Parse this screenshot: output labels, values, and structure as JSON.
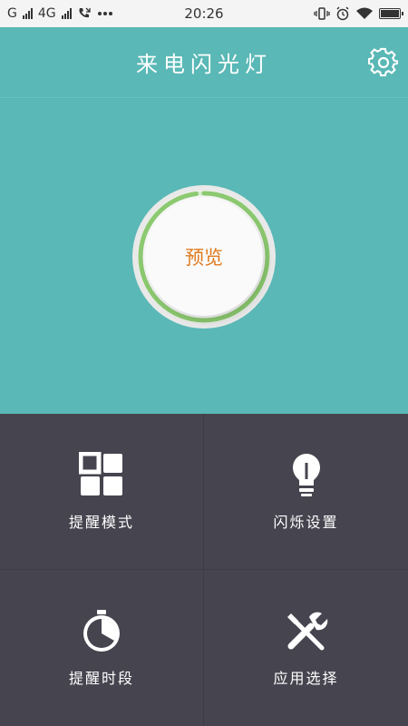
{
  "status_bar": {
    "carrier1": "G",
    "carrier2": "4G",
    "time": "20:26",
    "battery_level": 0.9
  },
  "header": {
    "title": "来电闪光灯"
  },
  "hero": {
    "preview_label": "预览",
    "progress": 0.98
  },
  "grid": {
    "items": [
      {
        "label": "提醒模式",
        "icon": "grid-icon"
      },
      {
        "label": "闪烁设置",
        "icon": "lightbulb-icon"
      },
      {
        "label": "提醒时段",
        "icon": "timer-icon"
      },
      {
        "label": "应用选择",
        "icon": "tools-icon"
      }
    ]
  },
  "colors": {
    "teal": "#5ab8b6",
    "dark": "#46444f",
    "accent_orange": "#e07a1f",
    "ring_green": "#8cc970"
  }
}
